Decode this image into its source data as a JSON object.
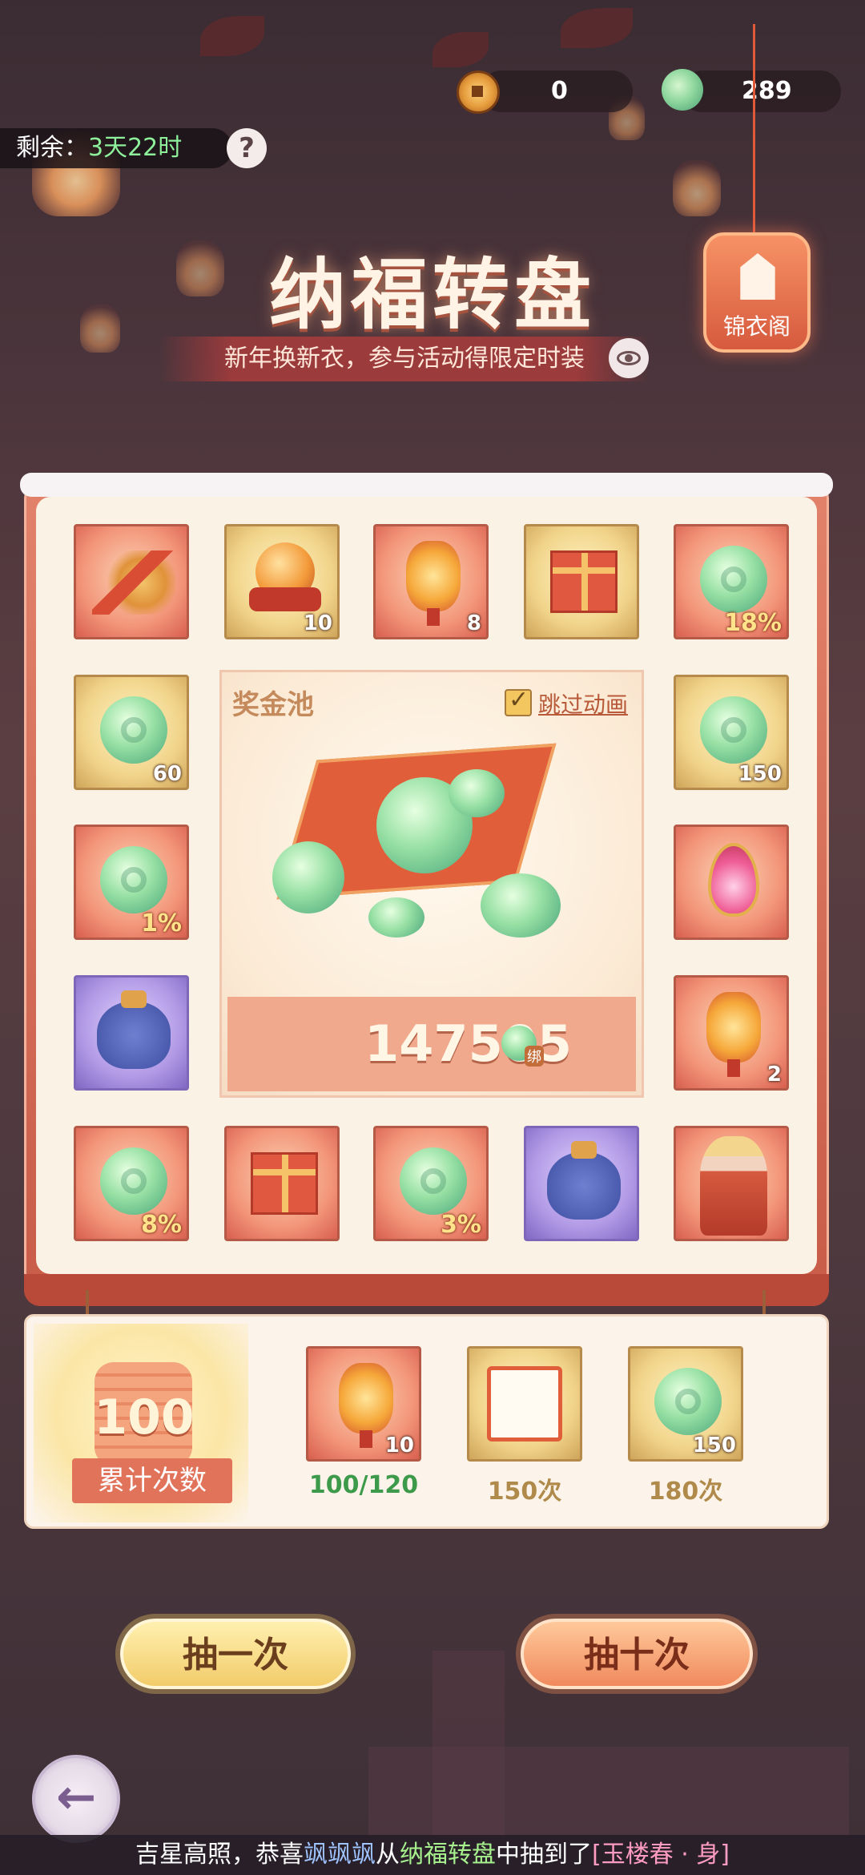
{
  "currency": {
    "coin_amount": "0",
    "jade_amount": "289"
  },
  "timer": {
    "label": "剩余：",
    "value": "3天22时"
  },
  "help_label": "?",
  "title": "纳福转盘",
  "subtitle": "新年换新衣，参与活动得限定时装",
  "wardrobe_label": "锦衣阁",
  "prize_pool": {
    "label": "奖金池",
    "skip_label": "跳过动画",
    "skip_checked": true,
    "amount": "147505",
    "bind_tag": "绑"
  },
  "grid": {
    "items": [
      {
        "name": "weapon",
        "qty": ""
      },
      {
        "name": "fire-orb",
        "qty": "10"
      },
      {
        "name": "lantern",
        "qty": "8"
      },
      {
        "name": "gift-box",
        "qty": ""
      },
      {
        "name": "jade",
        "qty": "18%"
      },
      {
        "name": "jade",
        "qty": "60"
      },
      {
        "name": "jade",
        "qty": "150"
      },
      {
        "name": "jade",
        "qty": "1%"
      },
      {
        "name": "petal-gem",
        "qty": ""
      },
      {
        "name": "lucky-bag",
        "qty": ""
      },
      {
        "name": "lantern",
        "qty": "2"
      },
      {
        "name": "jade",
        "qty": "8%"
      },
      {
        "name": "gift-box",
        "qty": ""
      },
      {
        "name": "jade",
        "qty": "3%"
      },
      {
        "name": "lucky-bag",
        "qty": ""
      },
      {
        "name": "hero-costume",
        "qty": ""
      }
    ]
  },
  "progress": {
    "count": "100",
    "count_label": "累计次数",
    "rewards": [
      {
        "qty": "10",
        "label": "100/120",
        "label_color": "#3d9a4a"
      },
      {
        "qty": "",
        "label": "150次",
        "label_color": "#b08a4a"
      },
      {
        "qty": "150",
        "label": "180次",
        "label_color": "#b08a4a"
      }
    ]
  },
  "buttons": {
    "draw_once": "抽一次",
    "draw_ten": "抽十次"
  },
  "ticker": {
    "prefix": "吉星高照，恭喜",
    "player": "飒飒飒",
    "middle": "从",
    "event": "纳福转盘",
    "suffix": "中抽到了",
    "prize": "[玉楼春 · 身]"
  }
}
